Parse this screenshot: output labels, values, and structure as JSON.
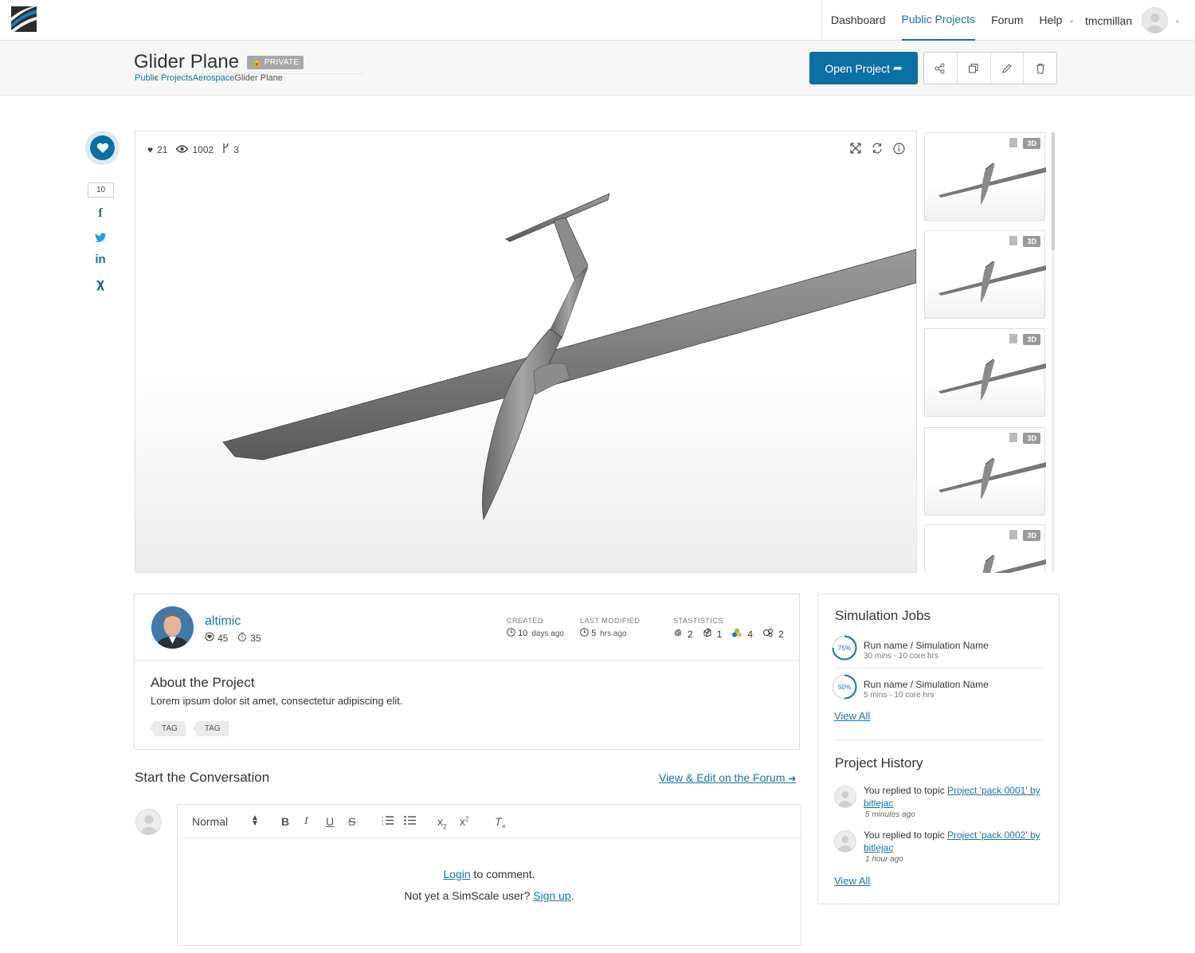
{
  "nav": {
    "items": [
      {
        "label": "Dashboard"
      },
      {
        "label": "Public Projects"
      },
      {
        "label": "Forum"
      },
      {
        "label": "Help"
      }
    ],
    "username": "tmcmillan"
  },
  "project": {
    "title": "Glider Plane",
    "visibility": "PRIVATE",
    "breadcrumb": [
      "Public Projects",
      "Aerospace",
      "Glider Plane"
    ],
    "open_button": "Open Project"
  },
  "social": {
    "share_count": "10",
    "networks": [
      "facebook-icon",
      "twitter-icon",
      "linkedin-icon",
      "xing-icon"
    ]
  },
  "viewer": {
    "likes": "21",
    "views": "1002",
    "forks": "3"
  },
  "thumbnails": [
    {
      "badge": "3D"
    },
    {
      "badge": "3D"
    },
    {
      "badge": "3D"
    },
    {
      "badge": "3D"
    },
    {
      "badge": "3D"
    }
  ],
  "author": {
    "name": "altimic",
    "reputation": "45",
    "hours": "35"
  },
  "meta": {
    "created_label": "CREATED",
    "created_value": "10",
    "created_unit": "days ago",
    "modified_label": "LAST MODIFIED",
    "modified_value": "5",
    "modified_unit": "hrs ago",
    "stats_label": "STASTISTICS",
    "stats": [
      "2",
      "1",
      "4",
      "2"
    ]
  },
  "about": {
    "title": "About the Project",
    "description": "Lorem ipsum dolor sit amet, consectetur adipiscing elit.",
    "tags": [
      "TAG",
      "TAG"
    ]
  },
  "conversation": {
    "title": "Start the Conversation",
    "forum_link": "View & Edit on the Forum",
    "format": "Normal",
    "login": "Login",
    "login_suffix": " to comment.",
    "signup_prefix": "Not yet a SimScale user? ",
    "signup": "Sign up",
    "signup_suffix": "."
  },
  "jobs": {
    "title": "Simulation Jobs",
    "items": [
      {
        "progress": "75%",
        "progress_value": 0.75,
        "name": "Run name / Simulation Name",
        "meta": "30 mins - 10 core hrs"
      },
      {
        "progress": "50%",
        "progress_value": 0.5,
        "name": "Run name / Simulation Name",
        "meta": "5 mins - 10 core hrs"
      }
    ],
    "view_all": "View All"
  },
  "history": {
    "title": "Project History",
    "items": [
      {
        "prefix": "You replied to topic ",
        "link": "Project 'pack 0001' by bitlejac",
        "when": "5 minutes ago"
      },
      {
        "prefix": "You replied to topic ",
        "link": "Project 'pack 0002' by bitlejac",
        "when": "1 hour ago"
      }
    ],
    "view_all": "View All"
  },
  "colors": {
    "accent": "#0a70a3",
    "link": "#1476a8"
  }
}
